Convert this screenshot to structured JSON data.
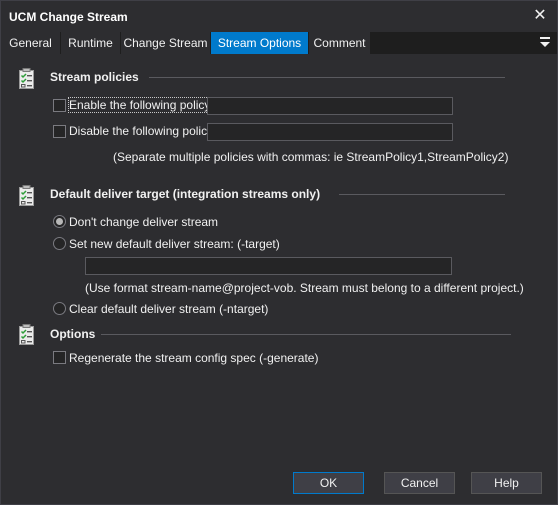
{
  "window": {
    "title": "UCM Change Stream",
    "close_glyph": "✕"
  },
  "tabs": [
    {
      "label": "General",
      "active": false
    },
    {
      "label": "Runtime",
      "active": false
    },
    {
      "label": "Change Stream",
      "active": false
    },
    {
      "label": "Stream Options",
      "active": true
    },
    {
      "label": "Comment",
      "active": false
    }
  ],
  "tab_menu_icon": "overflow-menu-icon",
  "sections": {
    "stream_policies": {
      "title": "Stream policies",
      "icon": "checklist-icon",
      "enable_policy": {
        "label": "Enable the following policy:",
        "checked": false,
        "value": ""
      },
      "disable_policy": {
        "label": "Disable the following policy:",
        "checked": false,
        "value": ""
      },
      "hint": "(Separate multiple policies with commas: ie StreamPolicy1,StreamPolicy2)"
    },
    "deliver_target": {
      "title": "Default deliver target (integration streams only)",
      "icon": "checklist-icon",
      "options": [
        {
          "label": "Don't change deliver stream",
          "selected": true
        },
        {
          "label": "Set new default deliver stream: (-target)",
          "selected": false
        },
        {
          "label": "Clear default deliver stream (-ntarget)",
          "selected": false
        }
      ],
      "target_value": "",
      "hint": "(Use format stream-name@project-vob. Stream must belong to a different project.)"
    },
    "options": {
      "title": "Options",
      "icon": "checklist-icon",
      "regenerate": {
        "label": "Regenerate the stream config spec (-generate)",
        "checked": false
      }
    }
  },
  "footer": {
    "ok": "OK",
    "cancel": "Cancel",
    "help": "Help"
  },
  "colors": {
    "background": "#2d2d30",
    "accent": "#007acc",
    "input_bg": "#252526",
    "text": "#f1f1f1"
  }
}
